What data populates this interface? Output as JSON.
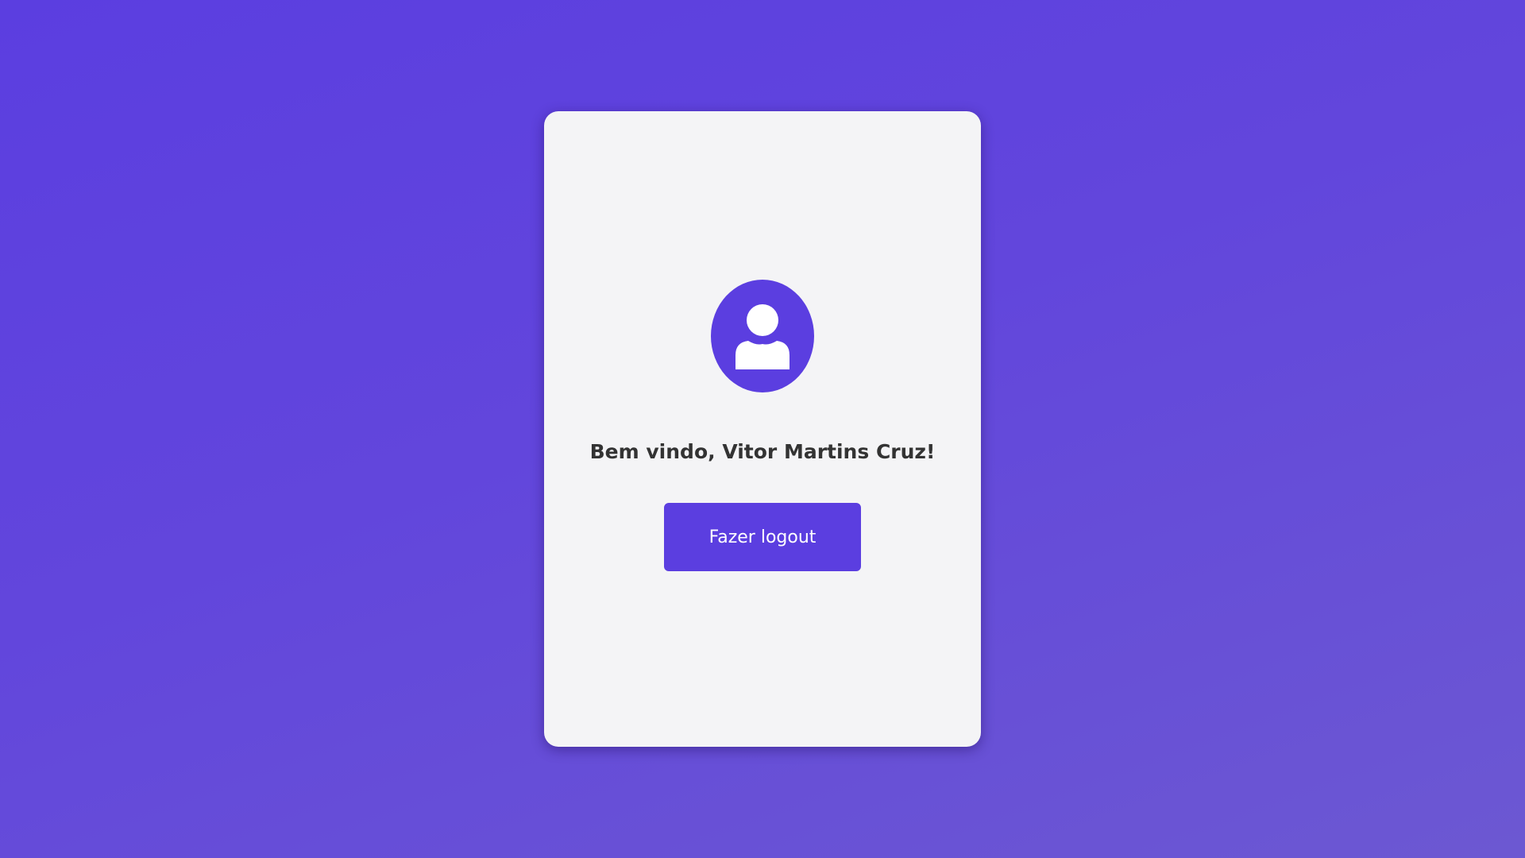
{
  "colors": {
    "accent": "#5b3ee0",
    "card_background": "#f4f4f6",
    "text": "#333333"
  },
  "avatar": {
    "icon": "user-icon"
  },
  "welcome": {
    "text": "Bem vindo, Vitor Martins Cruz!"
  },
  "logout": {
    "label": "Fazer logout"
  }
}
